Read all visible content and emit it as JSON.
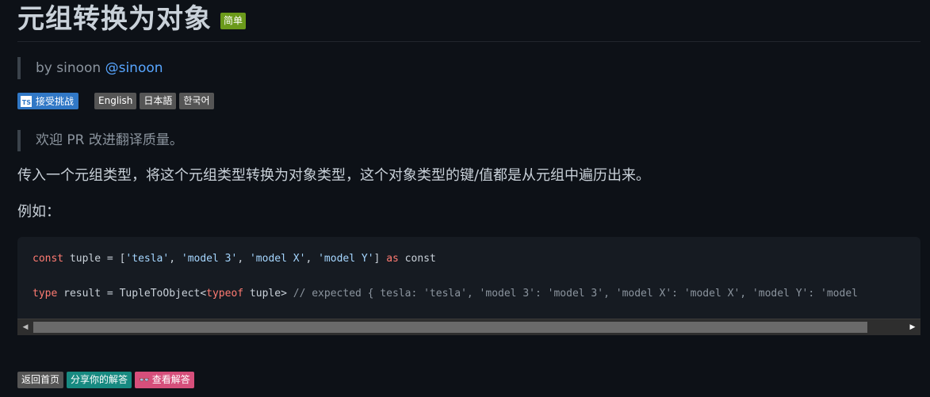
{
  "title": "元组转换为对象",
  "difficulty_badge": "简单",
  "author": {
    "prefix": "by sinoon",
    "handle": "@sinoon"
  },
  "challenge_badge": {
    "logo": "TS",
    "label": "接受挑战"
  },
  "languages": [
    "English",
    "日本語",
    "한국어"
  ],
  "translation_note": "欢迎 PR 改进翻译质量。",
  "description": "传入一个元组类型，将这个元组类型转换为对象类型，这个对象类型的键/值都是从元组中遍历出来。",
  "example_label": "例如：",
  "code": {
    "line1": {
      "k1": "const",
      "a": " tuple = [",
      "s1": "'tesla'",
      "c1": ", ",
      "s2": "'model 3'",
      "c2": ", ",
      "s3": "'model X'",
      "c3": ", ",
      "s4": "'model Y'",
      "b": "] ",
      "k2": "as",
      "c": " const"
    },
    "line2": {
      "k1": "type",
      "a": " result = TupleToObject<",
      "k2": "typeof",
      "b": " tuple> ",
      "comment": "// expected { tesla: 'tesla', 'model 3': 'model 3', 'model X': 'model X', 'model Y': 'model"
    }
  },
  "scrollbar": {
    "left_arrow": "◀",
    "right_arrow": "▶"
  },
  "actions": {
    "back": "返回首页",
    "share": "分享你的解答",
    "view": "查看解答",
    "view_icon": "👓"
  }
}
